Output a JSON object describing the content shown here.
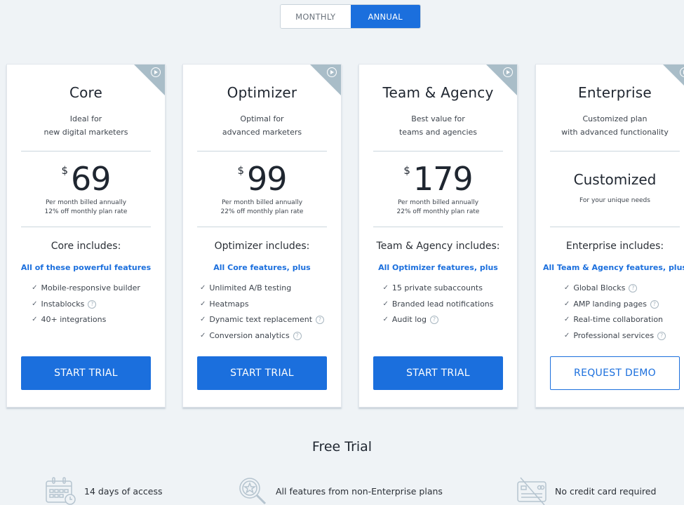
{
  "billing_toggle": {
    "options": [
      "MONTHLY",
      "ANNUAL"
    ],
    "selected": "ANNUAL"
  },
  "colors": {
    "accent": "#1b6fdd",
    "background": "#eff3f6",
    "corner_badge": "#a9bdc8"
  },
  "plans": [
    {
      "name": "Core",
      "desc_line1": "Ideal for",
      "desc_line2": "new digital marketers",
      "currency": "$",
      "price": "69",
      "note_line1": "Per month billed annually",
      "note_line2": "12% off monthly plan rate",
      "includes_title": "Core includes:",
      "includes_subtitle": "All of these powerful features",
      "features": [
        {
          "label": "Mobile-responsive builder",
          "help": false
        },
        {
          "label": "Instablocks",
          "help": true
        },
        {
          "label": "40+ integrations",
          "help": false
        }
      ],
      "button": "START TRIAL"
    },
    {
      "name": "Optimizer",
      "desc_line1": "Optimal for",
      "desc_line2": "advanced marketers",
      "currency": "$",
      "price": "99",
      "note_line1": "Per month billed annually",
      "note_line2": "22% off monthly plan rate",
      "includes_title": "Optimizer includes:",
      "includes_subtitle": "All Core features, plus",
      "features": [
        {
          "label": "Unlimited A/B testing",
          "help": false
        },
        {
          "label": "Heatmaps",
          "help": false
        },
        {
          "label": "Dynamic text replacement",
          "help": true
        },
        {
          "label": "Conversion analytics",
          "help": true
        }
      ],
      "button": "START TRIAL"
    },
    {
      "name": "Team & Agency",
      "desc_line1": "Best value for",
      "desc_line2": "teams and agencies",
      "currency": "$",
      "price": "179",
      "note_line1": "Per month billed annually",
      "note_line2": "22% off monthly plan rate",
      "includes_title": "Team & Agency includes:",
      "includes_subtitle": "All Optimizer features, plus",
      "features": [
        {
          "label": "15 private subaccounts",
          "help": false
        },
        {
          "label": "Branded lead notifications",
          "help": false
        },
        {
          "label": "Audit log",
          "help": true
        }
      ],
      "button": "START TRIAL"
    },
    {
      "name": "Enterprise",
      "desc_line1": "Customized plan",
      "desc_line2": "with advanced functionality",
      "price_text": "Customized",
      "price_note": "For your unique needs",
      "includes_title": "Enterprise includes:",
      "includes_subtitle": "All Team & Agency features, plus",
      "features": [
        {
          "label": "Global Blocks",
          "help": true
        },
        {
          "label": "AMP landing pages",
          "help": true
        },
        {
          "label": "Real-time collaboration",
          "help": false
        },
        {
          "label": "Professional services",
          "help": true
        }
      ],
      "button": "REQUEST DEMO"
    }
  ],
  "free_trial": {
    "title": "Free Trial",
    "items": [
      {
        "icon": "calendar-icon",
        "label": "14 days of access"
      },
      {
        "icon": "magnifier-star-icon",
        "label": "All features from non-Enterprise plans"
      },
      {
        "icon": "no-credit-card-icon",
        "label": "No credit card required"
      }
    ]
  },
  "ui": {
    "check_glyph": "✓",
    "help_glyph": "?"
  }
}
